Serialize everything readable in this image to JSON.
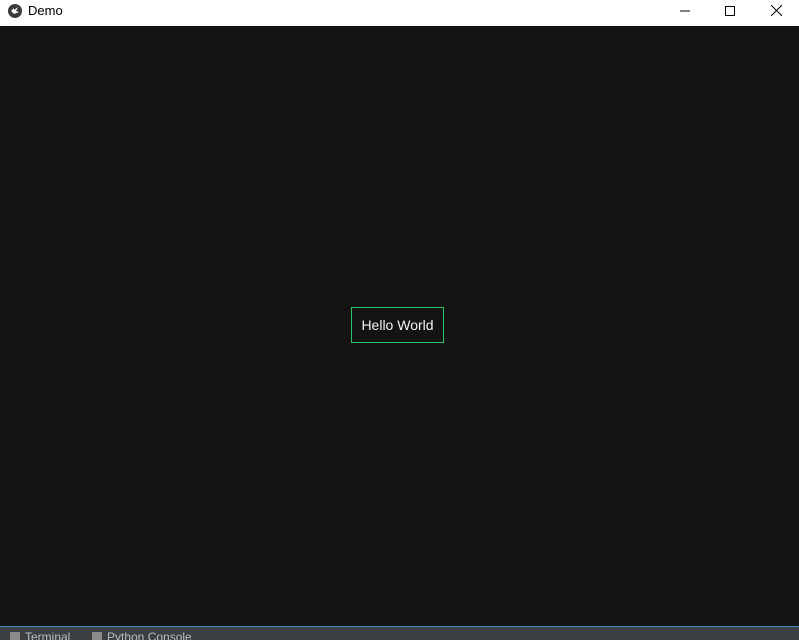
{
  "window": {
    "title": "Demo",
    "icon": "kivy-logo-icon",
    "controls": {
      "minimize": "minimize-icon",
      "maximize": "maximize-icon",
      "close": "close-icon"
    }
  },
  "content": {
    "background": "#131313",
    "button": {
      "label": "Hello World",
      "border_color": "#2fc36a"
    }
  },
  "toolstrip": {
    "tabs": [
      {
        "label": "Terminal",
        "icon": "terminal-icon"
      },
      {
        "label": "Python Console",
        "icon": "python-icon"
      }
    ]
  }
}
